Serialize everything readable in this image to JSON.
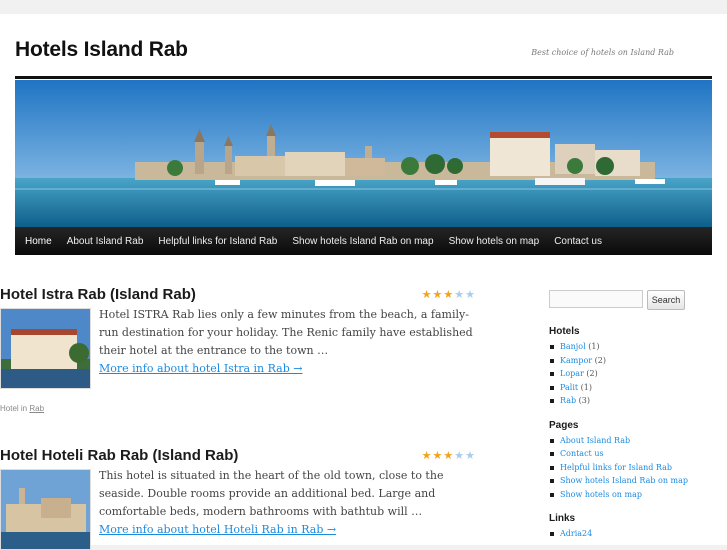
{
  "site": {
    "title": "Hotels Island Rab",
    "description": "Best choice of hotels on Island Rab"
  },
  "nav": {
    "items": [
      {
        "label": "Home",
        "current": true
      },
      {
        "label": "About Island Rab"
      },
      {
        "label": "Helpful links for Island Rab"
      },
      {
        "label": "Show hotels Island Rab on map"
      },
      {
        "label": "Show hotels on map"
      },
      {
        "label": "Contact us"
      }
    ]
  },
  "posts": [
    {
      "title": "Hotel Istra Rab (Island Rab)",
      "rating": 3,
      "rating_max": 5,
      "excerpt": "Hotel ISTRA Rab lies only a few minutes from the beach, a family-run destination for your holiday. The Renic family have established their hotel at the entrance to the town …",
      "more_link": "More info about hotel Istra in Rab →",
      "meta_prefix": "Hotel in",
      "meta_link": "Rab"
    },
    {
      "title": "Hotel Hoteli Rab Rab (Island Rab)",
      "rating": 3,
      "rating_max": 5,
      "excerpt": "This hotel is situated in the heart of the old town, close to the seaside. Double rooms provide an additional bed. Large and comfortable beds, modern bathrooms with bathtub will …",
      "more_link": "More info about hotel Hoteli Rab in Rab →"
    }
  ],
  "sidebar": {
    "search_button": "Search",
    "search_value": "",
    "hotels_title": "Hotels",
    "hotels": [
      {
        "label": "Banjol",
        "count": "(1)"
      },
      {
        "label": "Kampor",
        "count": "(2)"
      },
      {
        "label": "Lopar",
        "count": "(2)"
      },
      {
        "label": "Palit",
        "count": "(1)"
      },
      {
        "label": "Rab",
        "count": "(3)"
      }
    ],
    "pages_title": "Pages",
    "pages": [
      "About Island Rab",
      "Contact us",
      "Helpful links for Island Rab",
      "Show hotels Island Rab on map",
      "Show hotels on map"
    ],
    "links_title": "Links",
    "links": [
      "Adria24"
    ]
  },
  "colors": {
    "accent": "#1b8be0",
    "nav_bg": "#1a1a1a",
    "star_on": "#f2a21b",
    "star_off": "#a9cde9"
  }
}
